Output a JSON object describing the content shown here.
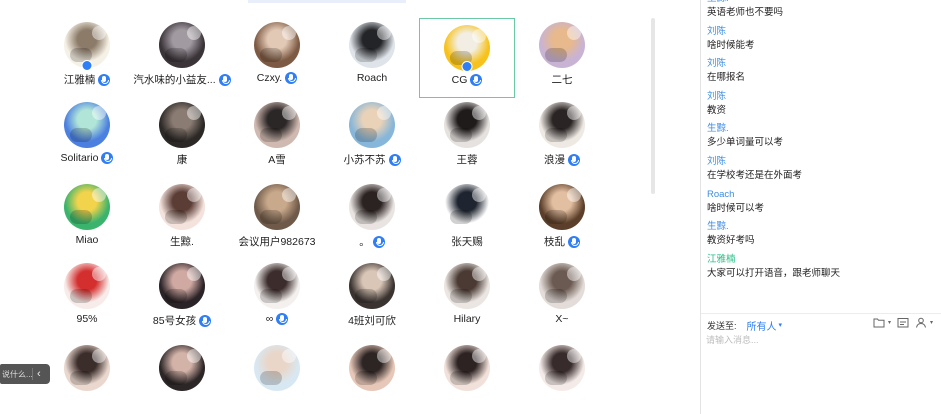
{
  "participants": [
    {
      "name": "江雅楠",
      "mic": true,
      "host": true,
      "selected": false,
      "colors": [
        "#f6f1e6",
        "#8c7b68"
      ]
    },
    {
      "name": "汽水味的小益友...",
      "mic": true,
      "host": false,
      "selected": false,
      "colors": [
        "#3a3338",
        "#a19aa1"
      ]
    },
    {
      "name": "Czxy.",
      "mic": true,
      "host": false,
      "selected": false,
      "colors": [
        "#7d5a44",
        "#e2c9b5"
      ]
    },
    {
      "name": "Roach",
      "mic": false,
      "host": false,
      "selected": false,
      "colors": [
        "#dfe4ea",
        "#232427"
      ]
    },
    {
      "name": "CG",
      "mic": true,
      "host": true,
      "selected": true,
      "colors": [
        "#f7c21b",
        "#f2eee3"
      ]
    },
    {
      "name": "二七",
      "mic": false,
      "host": false,
      "selected": false,
      "colors": [
        "#c8b3d5",
        "#e7b98c"
      ]
    },
    {
      "name": "Solitario",
      "mic": true,
      "host": false,
      "selected": false,
      "colors": [
        "#4b7fe0",
        "#b0e5d8"
      ]
    },
    {
      "name": "康",
      "mic": false,
      "host": false,
      "selected": false,
      "colors": [
        "#2b2826",
        "#8b7c73"
      ]
    },
    {
      "name": "A雪",
      "mic": false,
      "host": false,
      "selected": false,
      "colors": [
        "#cfb9b0",
        "#2c2727"
      ]
    },
    {
      "name": "小苏不苏",
      "mic": true,
      "host": false,
      "selected": false,
      "colors": [
        "#86b6d9",
        "#e9d2b8"
      ]
    },
    {
      "name": "王蓉",
      "mic": false,
      "host": false,
      "selected": false,
      "colors": [
        "#e6e2e0",
        "#1f1b1b"
      ]
    },
    {
      "name": "浪漫",
      "mic": true,
      "host": false,
      "selected": false,
      "colors": [
        "#efe9e4",
        "#2a2424"
      ]
    },
    {
      "name": "Miao",
      "mic": false,
      "host": false,
      "selected": false,
      "colors": [
        "#3ab46d",
        "#f2d34c"
      ]
    },
    {
      "name": "生黥.",
      "mic": false,
      "host": false,
      "selected": false,
      "colors": [
        "#f4e2dc",
        "#5b3d36"
      ]
    },
    {
      "name": "会议用户982673",
      "mic": false,
      "host": false,
      "selected": false,
      "colors": [
        "#6f5a49",
        "#c9a98b"
      ]
    },
    {
      "name": "。",
      "mic": true,
      "host": false,
      "selected": false,
      "colors": [
        "#e9e4e1",
        "#2b2222"
      ]
    },
    {
      "name": "张天赐",
      "mic": false,
      "host": false,
      "selected": false,
      "colors": [
        "#ffffff",
        "#1f2530"
      ]
    },
    {
      "name": "枝乱",
      "mic": true,
      "host": false,
      "selected": false,
      "colors": [
        "#5c3f2a",
        "#e3bfa1"
      ]
    },
    {
      "name": "95%",
      "mic": false,
      "host": false,
      "selected": false,
      "colors": [
        "#f7ece9",
        "#d42f2f"
      ]
    },
    {
      "name": "85号女孩",
      "mic": true,
      "host": false,
      "selected": false,
      "colors": [
        "#2a2327",
        "#d0a9a2"
      ]
    },
    {
      "name": "∞",
      "mic": true,
      "host": false,
      "selected": false,
      "colors": [
        "#f3f0ee",
        "#3c2d2c"
      ]
    },
    {
      "name": "4班刘可欣",
      "mic": false,
      "host": false,
      "selected": false,
      "colors": [
        "#3a3330",
        "#d9c6b7"
      ]
    },
    {
      "name": "Hilary",
      "mic": false,
      "host": false,
      "selected": false,
      "colors": [
        "#ece6e2",
        "#4a3a33"
      ]
    },
    {
      "name": "X~",
      "mic": false,
      "host": false,
      "selected": false,
      "colors": [
        "#e3dcd8",
        "#6b5a52"
      ]
    },
    {
      "name": "",
      "mic": false,
      "host": false,
      "selected": false,
      "colors": [
        "#ead8cf",
        "#3b2d2a"
      ]
    },
    {
      "name": "",
      "mic": false,
      "host": false,
      "selected": false,
      "colors": [
        "#2c2627",
        "#d3b3a8"
      ]
    },
    {
      "name": "",
      "mic": false,
      "host": false,
      "selected": false,
      "colors": [
        "#d8e8f3",
        "#e9d6c8"
      ]
    },
    {
      "name": "",
      "mic": false,
      "host": false,
      "selected": false,
      "colors": [
        "#e7c8b8",
        "#2d2424"
      ]
    },
    {
      "name": "",
      "mic": false,
      "host": false,
      "selected": false,
      "colors": [
        "#f1e1da",
        "#2e2323"
      ]
    },
    {
      "name": "",
      "mic": false,
      "host": false,
      "selected": false,
      "colors": [
        "#f4ebe8",
        "#382b2b"
      ]
    }
  ],
  "collapse_panel": {
    "text": "说什么...",
    "arrow": "‹"
  },
  "chat": {
    "messages": [
      {
        "sender": "生黥.",
        "text": "英语老师也不要吗",
        "green": false
      },
      {
        "sender": "刘陈",
        "text": "啥时候能考",
        "green": false
      },
      {
        "sender": "刘陈",
        "text": "在哪报名",
        "green": false
      },
      {
        "sender": "刘陈",
        "text": "教资",
        "green": false
      },
      {
        "sender": "生黥.",
        "text": "多少单词量可以考",
        "green": false
      },
      {
        "sender": "刘陈",
        "text": "在学校考还是在外面考",
        "green": false
      },
      {
        "sender": "Roach",
        "text": "啥时候可以考",
        "green": false
      },
      {
        "sender": "生黥.",
        "text": "教资好考吗",
        "green": false
      },
      {
        "sender": "江雅楠",
        "text": "大家可以打开语音，跟老师聊天",
        "green": true
      }
    ],
    "send_to_label": "发送至:",
    "send_to_target": "所有人",
    "send_to_caret": "▾",
    "input_placeholder": "请输入消息...",
    "tools": [
      {
        "icon": "folder-icon",
        "caret": "▾"
      },
      {
        "icon": "screenshot-icon",
        "caret": ""
      },
      {
        "icon": "person-icon",
        "caret": "▾"
      }
    ],
    "accent_blue": "#3c8ce7",
    "accent_green": "#2cbf88"
  }
}
